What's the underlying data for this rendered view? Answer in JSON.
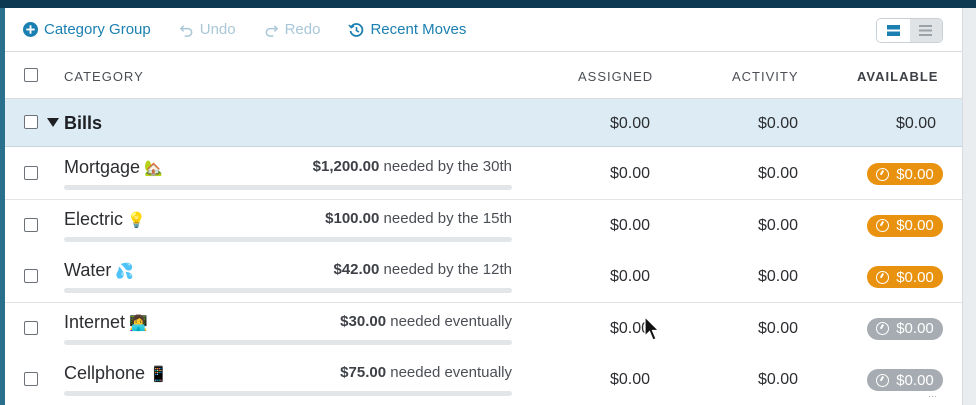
{
  "toolbar": {
    "category_group": "Category Group",
    "undo": "Undo",
    "redo": "Redo",
    "recent_moves": "Recent Moves"
  },
  "header": {
    "category": "CATEGORY",
    "assigned": "ASSIGNED",
    "activity": "ACTIVITY",
    "available": "AVAILABLE"
  },
  "group": {
    "name": "Bills",
    "assigned": "$0.00",
    "activity": "$0.00",
    "available": "$0.00"
  },
  "rows": [
    {
      "name": "Mortgage",
      "emoji": "🏡",
      "goal_amount": "$1,200.00",
      "goal_text": "needed by the 30th",
      "assigned": "$0.00",
      "activity": "$0.00",
      "available": "$0.00",
      "status": "underfunded"
    },
    {
      "name": "Electric",
      "emoji": "💡",
      "goal_amount": "$100.00",
      "goal_text": "needed by the 15th",
      "assigned": "$0.00",
      "activity": "$0.00",
      "available": "$0.00",
      "status": "underfunded"
    },
    {
      "name": "Water",
      "emoji": "💦",
      "goal_amount": "$42.00",
      "goal_text": "needed by the 12th",
      "assigned": "$0.00",
      "activity": "$0.00",
      "available": "$0.00",
      "status": "underfunded"
    },
    {
      "name": "Internet",
      "emoji": "👩‍💻",
      "goal_amount": "$30.00",
      "goal_text": "needed eventually",
      "assigned": "$0.00",
      "activity": "$0.00",
      "available": "$0.00",
      "status": "neutral"
    },
    {
      "name": "Cellphone",
      "emoji": "📱",
      "goal_amount": "$75.00",
      "goal_text": "needed eventually",
      "assigned": "$0.00",
      "activity": "$0.00",
      "available": "$0.00",
      "status": "neutral"
    }
  ],
  "colors": {
    "accent": "#1a7fb1",
    "underfunded": "#e8920f",
    "neutral": "#a6acb1",
    "group_bg": "#dcebf4"
  },
  "watermark": "···"
}
